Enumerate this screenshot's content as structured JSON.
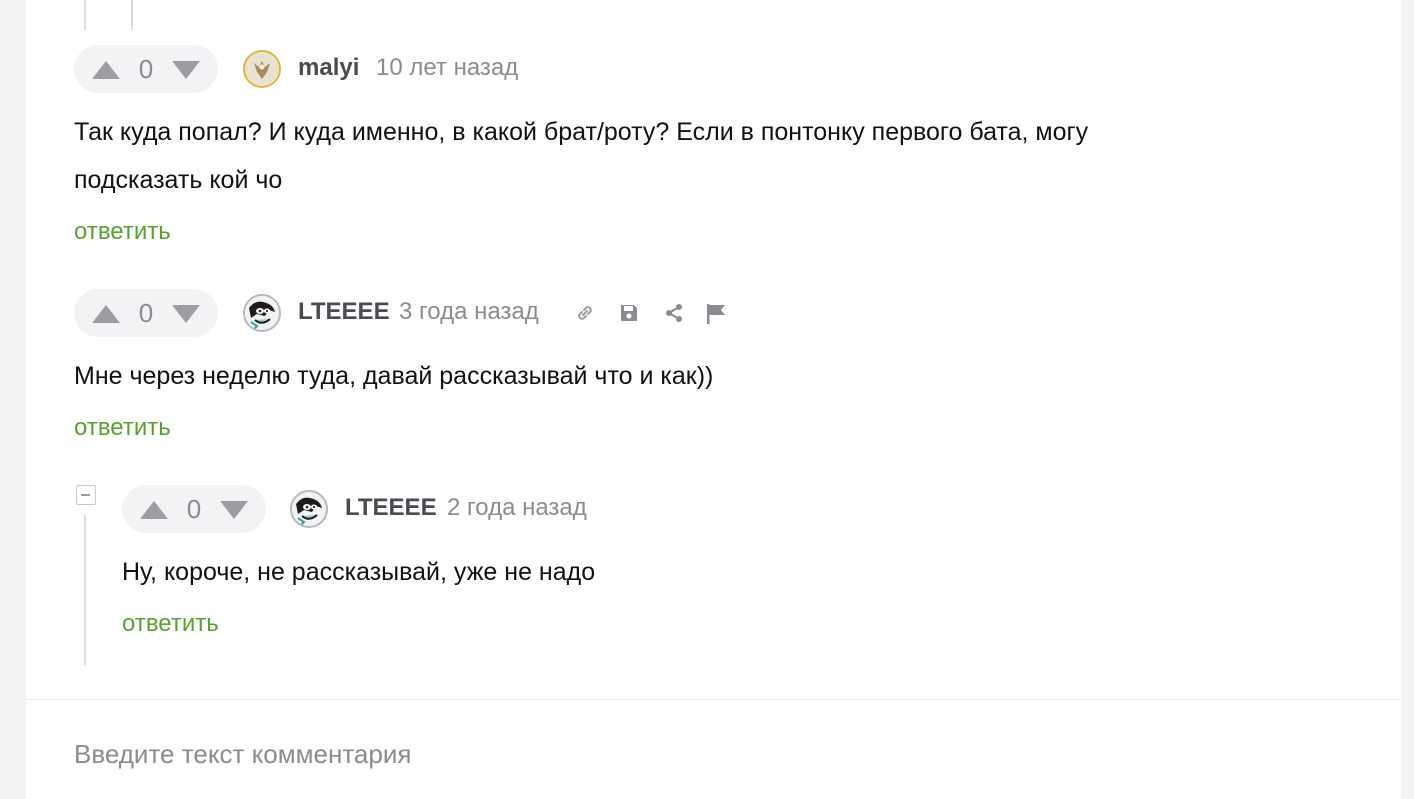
{
  "comments": [
    {
      "username": "malyi",
      "avatar_icon": "eagle-avatar-icon",
      "time": "10 лет назад",
      "votes": "0",
      "text_lines": [
        "Так куда попал? И куда именно, в какой брат/роту? Если в понтонку первого бата, могу",
        "подсказать кой чо"
      ],
      "reply_label": "ответить"
    },
    {
      "username": "LTEEEE",
      "avatar_icon": "cartoon-avatar-icon",
      "time": "3 года назад",
      "votes": "0",
      "text_lines": [
        "Мне через неделю туда, давай рассказывай что и как))"
      ],
      "reply_label": "ответить",
      "actions": [
        "link-icon",
        "save-icon",
        "share-icon",
        "flag-icon"
      ]
    },
    {
      "username": "LTEEEE",
      "avatar_icon": "cartoon-avatar-icon",
      "time": "2 года назад",
      "votes": "0",
      "text_lines": [
        "Ну, короче, не рассказывай, уже не надо"
      ],
      "reply_label": "ответить"
    }
  ],
  "comment_form": {
    "placeholder": "Введите текст комментария"
  },
  "colors": {
    "accent_green": "#5aa22f",
    "avatar_border_gold": "#e0b73a",
    "muted_gray": "#8b8b91"
  }
}
